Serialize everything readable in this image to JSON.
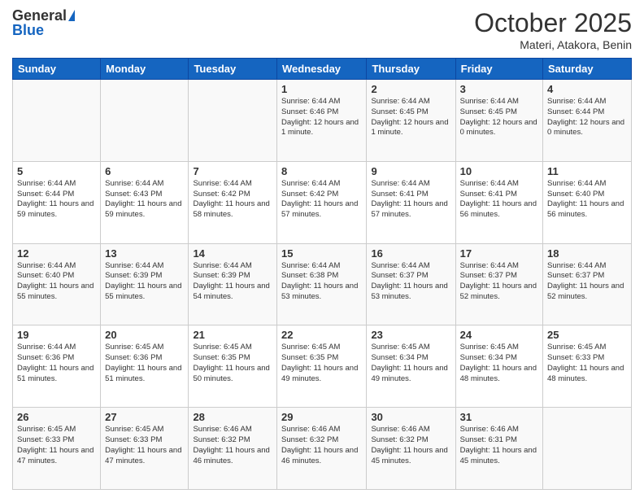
{
  "header": {
    "logo_general": "General",
    "logo_blue": "Blue",
    "title": "October 2025",
    "subtitle": "Materi, Atakora, Benin"
  },
  "days_of_week": [
    "Sunday",
    "Monday",
    "Tuesday",
    "Wednesday",
    "Thursday",
    "Friday",
    "Saturday"
  ],
  "weeks": [
    [
      {
        "day": "",
        "info": ""
      },
      {
        "day": "",
        "info": ""
      },
      {
        "day": "",
        "info": ""
      },
      {
        "day": "1",
        "info": "Sunrise: 6:44 AM\nSunset: 6:46 PM\nDaylight: 12 hours and 1 minute."
      },
      {
        "day": "2",
        "info": "Sunrise: 6:44 AM\nSunset: 6:45 PM\nDaylight: 12 hours and 1 minute."
      },
      {
        "day": "3",
        "info": "Sunrise: 6:44 AM\nSunset: 6:45 PM\nDaylight: 12 hours and 0 minutes."
      },
      {
        "day": "4",
        "info": "Sunrise: 6:44 AM\nSunset: 6:44 PM\nDaylight: 12 hours and 0 minutes."
      }
    ],
    [
      {
        "day": "5",
        "info": "Sunrise: 6:44 AM\nSunset: 6:44 PM\nDaylight: 11 hours and 59 minutes."
      },
      {
        "day": "6",
        "info": "Sunrise: 6:44 AM\nSunset: 6:43 PM\nDaylight: 11 hours and 59 minutes."
      },
      {
        "day": "7",
        "info": "Sunrise: 6:44 AM\nSunset: 6:42 PM\nDaylight: 11 hours and 58 minutes."
      },
      {
        "day": "8",
        "info": "Sunrise: 6:44 AM\nSunset: 6:42 PM\nDaylight: 11 hours and 57 minutes."
      },
      {
        "day": "9",
        "info": "Sunrise: 6:44 AM\nSunset: 6:41 PM\nDaylight: 11 hours and 57 minutes."
      },
      {
        "day": "10",
        "info": "Sunrise: 6:44 AM\nSunset: 6:41 PM\nDaylight: 11 hours and 56 minutes."
      },
      {
        "day": "11",
        "info": "Sunrise: 6:44 AM\nSunset: 6:40 PM\nDaylight: 11 hours and 56 minutes."
      }
    ],
    [
      {
        "day": "12",
        "info": "Sunrise: 6:44 AM\nSunset: 6:40 PM\nDaylight: 11 hours and 55 minutes."
      },
      {
        "day": "13",
        "info": "Sunrise: 6:44 AM\nSunset: 6:39 PM\nDaylight: 11 hours and 55 minutes."
      },
      {
        "day": "14",
        "info": "Sunrise: 6:44 AM\nSunset: 6:39 PM\nDaylight: 11 hours and 54 minutes."
      },
      {
        "day": "15",
        "info": "Sunrise: 6:44 AM\nSunset: 6:38 PM\nDaylight: 11 hours and 53 minutes."
      },
      {
        "day": "16",
        "info": "Sunrise: 6:44 AM\nSunset: 6:37 PM\nDaylight: 11 hours and 53 minutes."
      },
      {
        "day": "17",
        "info": "Sunrise: 6:44 AM\nSunset: 6:37 PM\nDaylight: 11 hours and 52 minutes."
      },
      {
        "day": "18",
        "info": "Sunrise: 6:44 AM\nSunset: 6:37 PM\nDaylight: 11 hours and 52 minutes."
      }
    ],
    [
      {
        "day": "19",
        "info": "Sunrise: 6:44 AM\nSunset: 6:36 PM\nDaylight: 11 hours and 51 minutes."
      },
      {
        "day": "20",
        "info": "Sunrise: 6:45 AM\nSunset: 6:36 PM\nDaylight: 11 hours and 51 minutes."
      },
      {
        "day": "21",
        "info": "Sunrise: 6:45 AM\nSunset: 6:35 PM\nDaylight: 11 hours and 50 minutes."
      },
      {
        "day": "22",
        "info": "Sunrise: 6:45 AM\nSunset: 6:35 PM\nDaylight: 11 hours and 49 minutes."
      },
      {
        "day": "23",
        "info": "Sunrise: 6:45 AM\nSunset: 6:34 PM\nDaylight: 11 hours and 49 minutes."
      },
      {
        "day": "24",
        "info": "Sunrise: 6:45 AM\nSunset: 6:34 PM\nDaylight: 11 hours and 48 minutes."
      },
      {
        "day": "25",
        "info": "Sunrise: 6:45 AM\nSunset: 6:33 PM\nDaylight: 11 hours and 48 minutes."
      }
    ],
    [
      {
        "day": "26",
        "info": "Sunrise: 6:45 AM\nSunset: 6:33 PM\nDaylight: 11 hours and 47 minutes."
      },
      {
        "day": "27",
        "info": "Sunrise: 6:45 AM\nSunset: 6:33 PM\nDaylight: 11 hours and 47 minutes."
      },
      {
        "day": "28",
        "info": "Sunrise: 6:46 AM\nSunset: 6:32 PM\nDaylight: 11 hours and 46 minutes."
      },
      {
        "day": "29",
        "info": "Sunrise: 6:46 AM\nSunset: 6:32 PM\nDaylight: 11 hours and 46 minutes."
      },
      {
        "day": "30",
        "info": "Sunrise: 6:46 AM\nSunset: 6:32 PM\nDaylight: 11 hours and 45 minutes."
      },
      {
        "day": "31",
        "info": "Sunrise: 6:46 AM\nSunset: 6:31 PM\nDaylight: 11 hours and 45 minutes."
      },
      {
        "day": "",
        "info": ""
      }
    ]
  ]
}
